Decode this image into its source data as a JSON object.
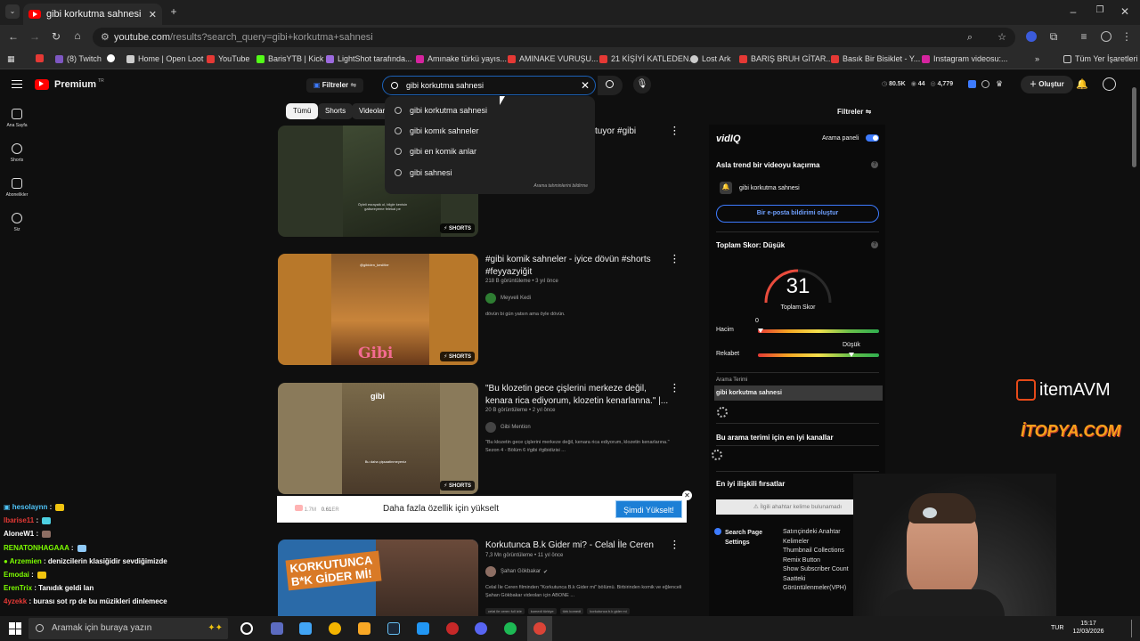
{
  "browser": {
    "tab_title": "gibi korkutma sahnesi - YouTube",
    "url_host": "youtube.com",
    "url_path": "/results?search_query=gibi+korkutma+sahnesi",
    "bookmarks": [
      "(8) Twitch",
      "Home | Open Loot",
      "YouTube",
      "BarisYTB | Kick",
      "LightShot tarafında...",
      "Amınake türkü yayıs...",
      "AMINAKE VURUŞU...",
      "21 KİŞİYİ KATLEDEN...",
      "Lost Ark",
      "BARIŞ BRUH GİTAR...",
      "Basık Bir Bisiklet - Y...",
      "Instagram videosu:..."
    ],
    "all_bookmarks": "Tüm Yer İşaretleri"
  },
  "youtube": {
    "logo": "Premium",
    "logo_country": "TR",
    "filter_button": "Filtreler",
    "search_value": "gibi korkutma sahnesi",
    "suggestions": [
      "gibi korkutma sahnesi",
      "gibi komık sahneler",
      "gibi en komik anlar",
      "gibi sahnesi"
    ],
    "suggest_footer": "Arama tahminlerini bildirme",
    "stats": {
      "views": "80.5K",
      "count1": "44",
      "count2": "4,779"
    },
    "create_button": "Oluştur",
    "sidebar": [
      {
        "label": "Ana Sayfa"
      },
      {
        "label": "Shorts"
      },
      {
        "label": "Abonelikler"
      },
      {
        "label": "Siz"
      }
    ],
    "chips": [
      "Tümü",
      "Shorts",
      "Videolar"
    ],
    "filters_right": "Filtreler",
    "videos": [
      {
        "title_fragment": "tuyor #gibi",
        "thumb_caption": "Öyleli esrayaik ol, bilgle kenisin galiseeyeme felekal pe",
        "shorts": "SHORTS"
      },
      {
        "title": "#gibi komik sahneler - iyice dövün #shorts #feyyazyiğit",
        "meta": "218 B görüntüleme • 3 yıl önce",
        "channel": "Meyveli Kedi",
        "desc": "dövün bi gün yatsın ama öyle dövün.",
        "thumb_top": "@gibiden_keslitler",
        "thumb_logo": "Gibi",
        "shorts": "SHORTS"
      },
      {
        "title": "\"Bu klozetin gece çişlerini merkeze değil, kenara rica ediyorum, klozetin kenarlanna.\" |...",
        "meta": "20 B görüntüleme • 2 yıl önce",
        "channel": "Gibi Mention",
        "desc": "\"Bu klozetin gece çişlerini merkeze değil, kenara rica ediyorum, klozetin kenarlarına.\" Sezon 4 - Bölüm 6 #gibi #gibidizisi ...",
        "thumb_logo": "gibi",
        "thumb_caption": "Bu daha çişsaatinmeyeniz",
        "shorts": "SHORTS"
      },
      {
        "title": "Korkutunca B.k Gider mi? - Celal İle Ceren",
        "meta": "7,3 Mn görüntüleme • 11 yıl önce",
        "channel": "Şahan Gökbakar",
        "desc": "Celal İle Ceren filminden \"Korkutunca B.k Gider mi\" bölümü. Birbirinden komik ve eğlenceli Şahan Gökbakar videoları için ABONE ...",
        "tags": [
          "celal ile ceren full izle",
          "komedi türkiye",
          "türk komedi",
          "korkutunca b.k gider mi"
        ],
        "thumb_text": "KORKUTUNCA B*K GİDER Mİ!"
      }
    ],
    "promo": {
      "views": "1.7M",
      "ratio": "0.61",
      "ratio_unit": "ER",
      "text": "Daha fazla özellik için yükselt",
      "button": "Şimdi Yükselt!"
    }
  },
  "vidiq": {
    "logo": "vidIQ",
    "panel_toggle": "Arama paneli",
    "trend_title": "Asla trend bir videoyu kaçırma",
    "trend_term": "gibi korkutma sahnesi",
    "email_button": "Bir e-posta bildirimi oluştur",
    "score_title": "Toplam Skor: Düşük",
    "score_value": "31",
    "score_label": "Toplam Skor",
    "volume_label": "Hacim",
    "volume_marker": "0",
    "competition_label": "Rekabet",
    "competition_marker": "Düşük",
    "search_term_label": "Arama Terimi",
    "search_term_value": "gibi korkutma sahnesi",
    "channels_title": "Bu arama terimi için en iyi kanallar",
    "opps_title": "En iyi ilişkili fırsatlar",
    "opps_empty": "İlgili ahahtar kelime bulunamadı",
    "settings_title": "Search Page Settings",
    "settings_items": [
      "Satırıçindeki Anahtar Kelimeler",
      "Thumbnail Collections",
      "Remix Button",
      "Show Subscriber Count",
      "Saatteki Görüntülenmeler(VPH)"
    ]
  },
  "overlay": {
    "sponsor1": "itemAVM",
    "sponsor2": "İTOPYA.COM"
  },
  "chat": [
    {
      "user": "hesolaynn",
      "color": "#4fc3f7",
      "msg": ""
    },
    {
      "user": "lbarise11",
      "color": "#e53935",
      "msg": ""
    },
    {
      "user": "AloneW1",
      "color": "#ffffff",
      "msg": ""
    },
    {
      "user": "RENATONHAGAAA",
      "color": "#7cfc00",
      "msg": ""
    },
    {
      "user": "Arzemien",
      "color": "#7cfc00",
      "msg": "denizcilerin klasiğidir sevdiğimizde"
    },
    {
      "user": "Emodai",
      "color": "#7cfc00",
      "msg": ""
    },
    {
      "user": "ErenTrix",
      "color": "#7cfc00",
      "msg": "Tanıdık geldi lan"
    },
    {
      "user": "4yzekk",
      "color": "#e53935",
      "msg": "burası sot rp de bu müzikleri dinlemece"
    }
  ],
  "taskbar": {
    "search_placeholder": "Aramak için buraya yazın",
    "lang": "TUR",
    "time": "15:17",
    "date": "12/03/2026"
  },
  "colors": {
    "youtube_red": "#ff0000",
    "vidiq_blue": "#3d7bff",
    "upgrade_blue": "#1c7fd6"
  }
}
